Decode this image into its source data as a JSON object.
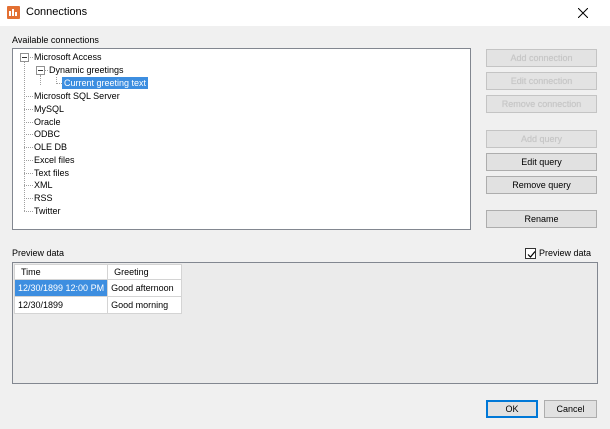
{
  "window": {
    "title": "Connections",
    "close_glyph": "✕"
  },
  "connections": {
    "label": "Available connections",
    "tree": {
      "root": "Microsoft Access",
      "child": "Dynamic greetings",
      "selected": "Current greeting text",
      "others": [
        "Microsoft SQL Server",
        "MySQL",
        "Oracle",
        "ODBC",
        "OLE DB",
        "Excel files",
        "Text files",
        "XML",
        "RSS",
        "Twitter"
      ]
    }
  },
  "buttons": {
    "add_connection": "Add connection",
    "edit_connection": "Edit connection",
    "remove_connection": "Remove connection",
    "add_query": "Add query",
    "edit_query": "Edit query",
    "remove_query": "Remove query",
    "rename": "Rename",
    "ok": "OK",
    "cancel": "Cancel"
  },
  "preview": {
    "label": "Preview data",
    "checkbox_label": "Preview data",
    "checkbox_checked": true,
    "columns": [
      "Time",
      "Greeting"
    ],
    "rows": [
      [
        "12/30/1899 12:00 PM",
        "Good afternoon"
      ],
      [
        "12/30/1899",
        "Good morning"
      ]
    ]
  },
  "colors": {
    "accent": "#3d8ee0",
    "app_icon": "#e37033"
  }
}
